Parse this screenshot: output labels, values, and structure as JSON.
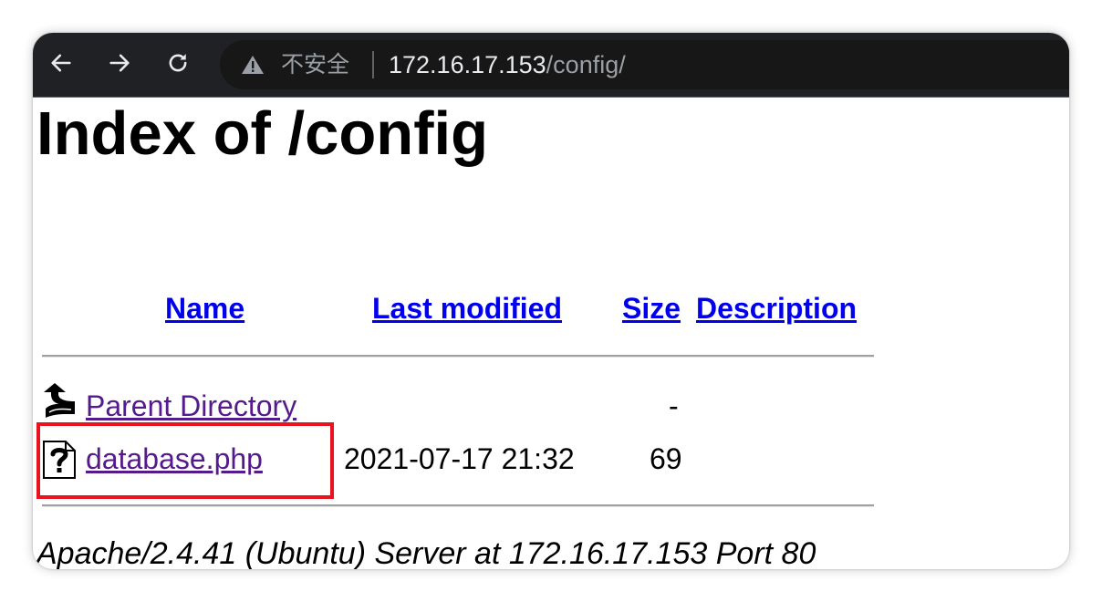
{
  "browser": {
    "back_icon": "arrow-left-icon",
    "forward_icon": "arrow-right-icon",
    "reload_icon": "reload-icon",
    "warning_icon": "warning-triangle-icon",
    "security_label": "不安全",
    "url_host": "172.16.17.153",
    "url_path": "/config/"
  },
  "page": {
    "title": "Index of /config",
    "columns": {
      "name": "Name",
      "last_modified": "Last modified",
      "size": "Size",
      "description": "Description"
    },
    "rows": [
      {
        "icon": "parent-directory-icon",
        "name": "Parent Directory",
        "last_modified": "",
        "size": "-",
        "description": ""
      },
      {
        "icon": "unknown-file-icon",
        "name": "database.php",
        "last_modified": "2021-07-17 21:32",
        "size": "69",
        "description": ""
      }
    ],
    "footer": "Apache/2.4.41 (Ubuntu) Server at 172.16.17.153 Port 80"
  },
  "colors": {
    "link": "#0000ee",
    "visited_link": "#551a8b",
    "highlight_box": "#e8131f",
    "toolbar": "#202124"
  }
}
